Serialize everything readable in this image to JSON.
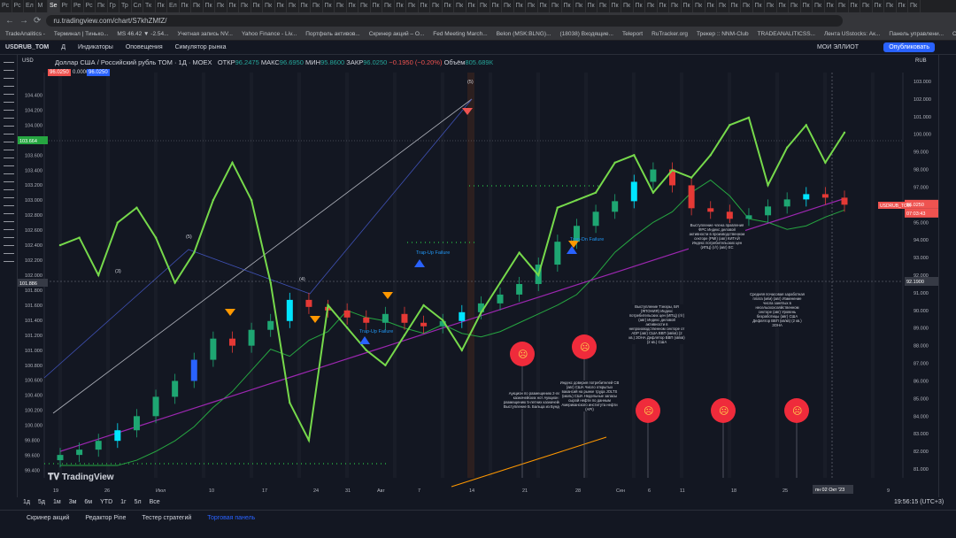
{
  "browser": {
    "tabs": [
      "Рс",
      "Рс",
      "Ел",
      "М",
      "Se",
      "Pr",
      "Ре",
      "Pc",
      "Пк",
      "Гр",
      "Тр",
      "Сл",
      "Тк",
      "Пк",
      "Ел",
      "Пк",
      "Пк",
      "Пк",
      "Пк",
      "Пк",
      "Пк",
      "Пк",
      "Пк",
      "Пк",
      "Пк",
      "Пк",
      "Пк",
      "Пк",
      "Пк",
      "Пк",
      "Пк",
      "Пк",
      "Пк",
      "Пк",
      "Пк",
      "Пк",
      "Пк",
      "Пк",
      "Пк",
      "Пк",
      "Пк",
      "Пк",
      "Пк",
      "Пк",
      "Пк",
      "Пк",
      "Пк",
      "Пк",
      "Пк",
      "Пк",
      "Пк",
      "Пк",
      "Пк",
      "Пк",
      "Пк",
      "Пк",
      "Пк",
      "Пк",
      "Пк",
      "Пк",
      "Пк",
      "Пк",
      "Пк",
      "Пк",
      "Пк",
      "Пк",
      "Пк",
      "Пк",
      "Пк",
      "Пк",
      "Пк",
      "Пк",
      "Пк",
      "Пк",
      "Пк",
      "Пк",
      "Пк"
    ],
    "url": "ru.tradingview.com/chart/S7khZMfZ/",
    "bookmarks": [
      "TradeAnalitics -",
      "Терминал | Тинько...",
      "MS 46.42 ▼ -2.54...",
      "Учетная запись NV...",
      "Yahoo Finance - Liv...",
      "Портфель активов...",
      "Скринер акций – O...",
      "Fed Meeting March...",
      "Belon (MSK:BLNG)...",
      "(18038) Входящие...",
      "Teleport",
      "RuTracker.org",
      "Трекер :: NNM-Club",
      "TRADEANALITICSS...",
      "Лента USstocks: Ак...",
      "Панель управлени...",
      "Студия Rutube"
    ]
  },
  "toolbar": {
    "symbol": "USDRUB_TOM",
    "interval": "Д",
    "indicators": "Индикаторы",
    "alerts": "Оповещения",
    "replay": "Симулятор рынка",
    "my_ideas": "МОИ ЭЛЛИОТ",
    "publish": "Опубликовать"
  },
  "legend": {
    "title": "Доллар США / Российский рубль TOM · 1Д · MOEX",
    "o_label": "ОТКР",
    "o": "96.2475",
    "h_label": "МАКС",
    "h": "96.6950",
    "l_label": "МИН",
    "l": "95.8600",
    "c_label": "ЗАКР",
    "c": "96.0250",
    "chg": "−0.1950 (−0.20%)",
    "vol_label": "Объём",
    "vol": "805.689К",
    "bid": "96.0250",
    "spread": "0.0000",
    "ask": "96.0250",
    "currency_left": "USD",
    "currency_right": "RUB"
  },
  "chart_data": {
    "type": "candlestick",
    "symbol": "USDRUB_TOM",
    "left_axis": {
      "ylim": [
        99.3,
        104.7
      ],
      "ticks": [
        "104.400",
        "104.200",
        "104.000",
        "103.800",
        "103.600",
        "103.400",
        "103.200",
        "103.000",
        "102.800",
        "102.600",
        "102.400",
        "102.200",
        "102.000",
        "101.800",
        "101.600",
        "101.400",
        "101.200",
        "101.000",
        "100.800",
        "100.600",
        "100.400",
        "100.200",
        "100.000",
        "99.800",
        "99.600",
        "99.400"
      ]
    },
    "right_axis": {
      "ylim": [
        80.5,
        103.5
      ],
      "ticks": [
        "103.000",
        "102.000",
        "101.000",
        "100.000",
        "99.000",
        "98.000",
        "97.000",
        "96.000",
        "95.000",
        "94.000",
        "93.000",
        "92.000",
        "91.000",
        "90.000",
        "89.000",
        "88.000",
        "87.000",
        "86.000",
        "85.000",
        "84.000",
        "83.000",
        "82.000",
        "81.000"
      ]
    },
    "x_ticks": [
      "19",
      "26",
      "Июл",
      "10",
      "17",
      "24",
      "31",
      "Авг",
      "7",
      "14",
      "21",
      "28",
      "Сен",
      "6",
      "11",
      "18",
      "25",
      "2",
      "9"
    ],
    "last_price": "96.0250",
    "countdown": "07:03:43",
    "crosshair_price": "92.1900",
    "crosshair_date": "пн 02 Окт '23",
    "left_marker_1": "103.664",
    "left_marker_2": "101.886",
    "price_line_label": "USDRUB_TOM",
    "closes": [
      81.8,
      82.1,
      82.6,
      83.2,
      84.0,
      85.1,
      86.0,
      87.2,
      88.4,
      88.0,
      88.9,
      89.4,
      90.6,
      90.2,
      90.0,
      89.6,
      89.3,
      89.8,
      89.3,
      89.1,
      89.4,
      89.9,
      90.4,
      90.9,
      91.5,
      92.6,
      93.9,
      94.8,
      95.6,
      96.2,
      97.3,
      98.0,
      97.1,
      95.8,
      95.6,
      95.2,
      95.4,
      95.9,
      96.3,
      96.6,
      96.4,
      96.0
    ],
    "opens": [
      81.5,
      81.8,
      82.1,
      82.6,
      83.2,
      84.0,
      85.1,
      86.0,
      87.2,
      88.4,
      88.0,
      88.9,
      89.4,
      90.6,
      90.2,
      90.0,
      89.6,
      89.3,
      89.8,
      89.3,
      89.1,
      89.4,
      89.9,
      90.4,
      90.9,
      91.5,
      92.6,
      93.9,
      94.8,
      95.6,
      96.2,
      97.3,
      98.0,
      97.1,
      95.8,
      95.6,
      95.2,
      95.4,
      95.9,
      96.3,
      96.6,
      96.4
    ],
    "oscillator": [
      102.4,
      102.5,
      102.0,
      102.7,
      102.9,
      102.5,
      101.9,
      102.3,
      103.0,
      103.5,
      103.0,
      101.9,
      100.3,
      99.8,
      101.6,
      101.3,
      101.0,
      100.8,
      101.2,
      101.6,
      101.4,
      101.0,
      101.5,
      101.9,
      102.3,
      102.0,
      102.9,
      103.0,
      103.1,
      103.5,
      103.6,
      103.1,
      103.4,
      103.3,
      103.6,
      104.0,
      104.1,
      103.2,
      103.7,
      104.0,
      103.5,
      103.9
    ],
    "labels": [
      "(5)",
      "(5)",
      "(3)",
      "(4)",
      "Trap-Up Failure",
      "Trap-Up Failure",
      "Trap-Dn Failure"
    ],
    "events": [
      "Аукцион по размещению 2-летних казначейских нот Аукцион по размещению 5-летних казначейских нот Выступление Б. Бальца из Бундесбанка",
      "Индекс доверия потребителей CB (авг) США Число открытых вакансий на рынке труда JOLTS (июль) США Недельные запасы сырой нефти по данным Американского института нефти (API)",
      "Выступление Тэнэры, БЯ (ЯПОНИЯ) Индекс потребительских цен (ИПЦ) (г/г) (авг) Индекс деловой активности в непроизводственном секторе от ADP (авг) США ВВП (кв/кв) (2 кв.) ЗОНА Дефлятор ВВП (кв/кв) (2 кв.) США",
      "Выступление члена правления ФРС Индекс деловой активности в производственном секторе (PMI) (авг) КИТАЙ Индекс потребительских цен (ИПЦ) (г/г) (авг) ЕС",
      "Средняя почасовая заработная плата (м/м) (авг) Изменение числа занятых в несельскохозяйственном секторе (авг) Уровень безработицы (авг) США Дефлятор ВВП (кв/кв) (2 кв.) ЗОНА"
    ]
  },
  "timeframes": [
    "1д",
    "5д",
    "1м",
    "3м",
    "6м",
    "YTD",
    "1г",
    "5л",
    "Все"
  ],
  "clock": "19:56:15 (UTC+3)",
  "bottom_tabs": [
    "Скринер акций",
    "Редактор Pine",
    "Тестер стратегий",
    "Торговая панель"
  ],
  "brand": "TradingView"
}
